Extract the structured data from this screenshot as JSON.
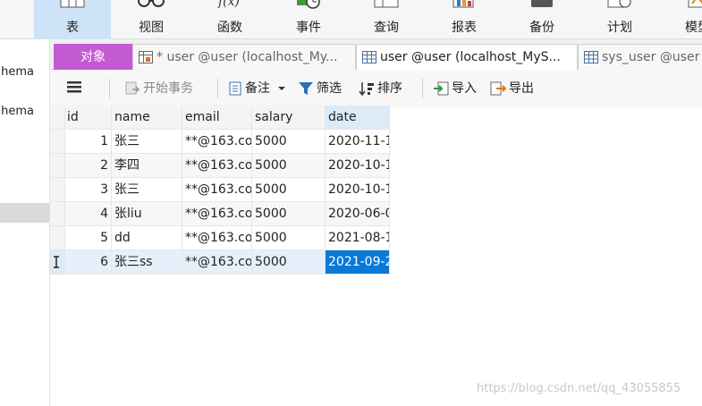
{
  "ribbon": {
    "items": [
      {
        "label": "表",
        "icon": "table-icon"
      },
      {
        "label": "视图",
        "icon": "glasses-icon"
      },
      {
        "label": "函数",
        "icon": "function-icon"
      },
      {
        "label": "事件",
        "icon": "clock-icon"
      },
      {
        "label": "查询",
        "icon": "query-table-icon"
      },
      {
        "label": "报表",
        "icon": "report-icon"
      },
      {
        "label": "备份",
        "icon": "backup-icon"
      },
      {
        "label": "计划",
        "icon": "schedule-icon"
      },
      {
        "label": "模型",
        "icon": "model-icon"
      }
    ],
    "active_index": 0
  },
  "nav": {
    "items": [
      "hema",
      "hema"
    ]
  },
  "tabs": {
    "objects": "对象",
    "tab1": "* user @user (localhost_My...",
    "tab2": "user @user (localhost_MyS...",
    "tab3": "sys_user @user"
  },
  "toolbar": {
    "menu_icon": "hamburger-icon",
    "begin_transaction": "开始事务",
    "note": "备注",
    "filter": "筛选",
    "sort": "排序",
    "import": "导入",
    "export": "导出"
  },
  "grid": {
    "columns": [
      "id",
      "name",
      "email",
      "salary",
      "date"
    ],
    "rows": [
      {
        "id": "1",
        "name": "张三",
        "email": "**@163.co",
        "salary": "5000",
        "date": "2020-11-1"
      },
      {
        "id": "2",
        "name": "李四",
        "email": "**@163.co",
        "salary": "5000",
        "date": "2020-10-1"
      },
      {
        "id": "3",
        "name": "张三",
        "email": "**@163.co",
        "salary": "5000",
        "date": "2020-10-1"
      },
      {
        "id": "4",
        "name": "张liu",
        "email": "**@163.co",
        "salary": "5000",
        "date": "2020-06-0"
      },
      {
        "id": "5",
        "name": "dd",
        "email": "**@163.co",
        "salary": "5000",
        "date": "2021-08-1"
      },
      {
        "id": "6",
        "name": "张三ss",
        "email": "**@163.co",
        "salary": "5000",
        "date": "2021-09-2"
      }
    ]
  },
  "watermark": "https://blog.csdn.net/qq_43055855",
  "colors": {
    "objects_tab": "#c45ad3",
    "ribbon_active": "#cde3f7",
    "selected_cell": "#0a78d7"
  }
}
